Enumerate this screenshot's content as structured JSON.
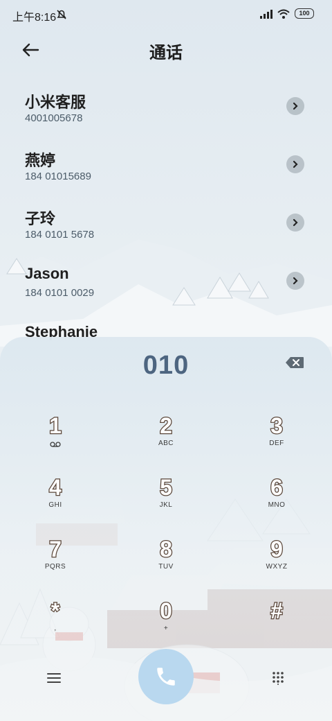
{
  "status_bar": {
    "time": "上午8:16",
    "battery": "100"
  },
  "header": {
    "title": "通话"
  },
  "contacts": [
    {
      "name": "小米客服",
      "number": "4001005678"
    },
    {
      "name": "燕婷",
      "number": "184 01015689"
    },
    {
      "name": "子玲",
      "number": "184 0101 5678"
    },
    {
      "name": "Jason",
      "number": "184 0101 0029"
    },
    {
      "name": "Stephanie",
      "number": ""
    }
  ],
  "dialer": {
    "input": "010",
    "keys": [
      {
        "digit": "1",
        "letters": ""
      },
      {
        "digit": "2",
        "letters": "ABC"
      },
      {
        "digit": "3",
        "letters": "DEF"
      },
      {
        "digit": "4",
        "letters": "GHI"
      },
      {
        "digit": "5",
        "letters": "JKL"
      },
      {
        "digit": "6",
        "letters": "MNO"
      },
      {
        "digit": "7",
        "letters": "PQRS"
      },
      {
        "digit": "8",
        "letters": "TUV"
      },
      {
        "digit": "9",
        "letters": "WXYZ"
      },
      {
        "digit": "*",
        "letters": ","
      },
      {
        "digit": "0",
        "letters": "+"
      },
      {
        "digit": "#",
        "letters": ""
      }
    ]
  },
  "icons": {
    "back": "back-arrow-icon",
    "backspace": "backspace-icon",
    "voicemail": "voicemail-icon",
    "menu": "menu-icon",
    "call": "phone-icon",
    "keypad": "keypad-icon",
    "detail": "chevron-right-icon"
  },
  "colors": {
    "accent": "#4d6580",
    "call_button": "#b9d8ef"
  }
}
